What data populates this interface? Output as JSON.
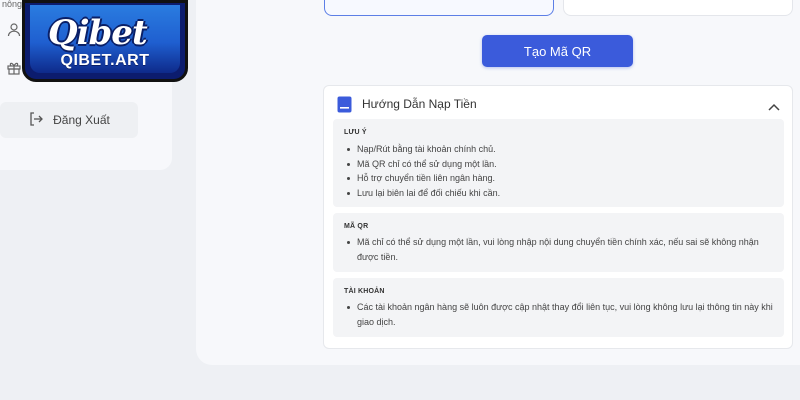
{
  "sidebar": {
    "partial_label": "nông",
    "logout_label": "Đăng Xuất"
  },
  "logo": {
    "brand": "Qibet",
    "domain": "QIBET.ART"
  },
  "actions": {
    "create_qr_label": "Tạo Mã QR"
  },
  "guide": {
    "title": "Hướng Dẫn Nạp Tiền",
    "expanded": true,
    "sections": [
      {
        "heading": "LƯU Ý",
        "items": [
          "Nạp/Rút bằng tài khoản chính chủ.",
          "Mã QR chỉ có thể sử dụng một lần.",
          "Hỗ trợ chuyển tiền liên ngân hàng.",
          "Lưu lại biên lai để đối chiếu khi cần."
        ]
      },
      {
        "heading": "MÃ QR",
        "items": [
          "Mã chỉ có thể sử dụng một lần, vui lòng nhập nội dung chuyển tiền chính xác, nếu sai sẽ không nhận được tiền."
        ]
      },
      {
        "heading": "TÀI KHOẢN",
        "items": [
          "Các tài khoản ngân hàng sẽ luôn được cập nhật thay đổi liên tục, vui lòng không lưu lại thông tin này khi giao dịch."
        ]
      }
    ]
  },
  "colors": {
    "primary": "#3b5bdb",
    "page_bg": "#eef0f4",
    "panel_bg": "#f7f8fb",
    "section_bg": "#f3f4f6"
  }
}
